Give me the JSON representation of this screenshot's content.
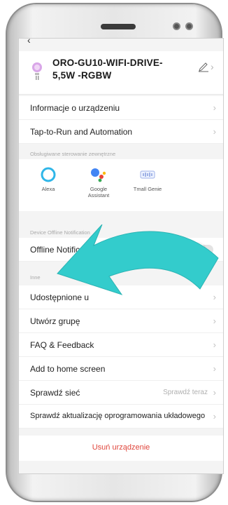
{
  "device": {
    "name": "ORO-GU10-WIFI-DRIVE-5,5W -RGBW"
  },
  "menu": {
    "device_info": "Informacje o urządzeniu",
    "tap_to_run": "Tap-to-Run and Automation"
  },
  "assistants_section": {
    "title": "Obsługiwane sterowanie zewnętrzne",
    "items": [
      {
        "label": "Alexa",
        "icon": "alexa-icon"
      },
      {
        "label": "Google\nAssistant",
        "icon": "google-assistant-icon"
      },
      {
        "label": "Tmall Genie",
        "icon": "tmall-genie-icon"
      }
    ]
  },
  "offline_section": {
    "title": "Device Offline Notification",
    "label": "Offline Notification",
    "enabled": false
  },
  "other_section": {
    "title": "Inne",
    "items": [
      {
        "label": "Udostępnione u"
      },
      {
        "label": "Utwórz grupę"
      },
      {
        "label": "FAQ & Feedback"
      },
      {
        "label": "Add to home screen"
      },
      {
        "label": "Sprawdź sieć",
        "value": "Sprawdź teraz"
      },
      {
        "label": "Sprawdź aktualizację oprogramowania układowego"
      }
    ]
  },
  "remove_device": "Usuń urządzenie",
  "colors": {
    "accent_arrow": "#33cccc",
    "danger": "#e0463c",
    "background": "#f4f4f4"
  }
}
